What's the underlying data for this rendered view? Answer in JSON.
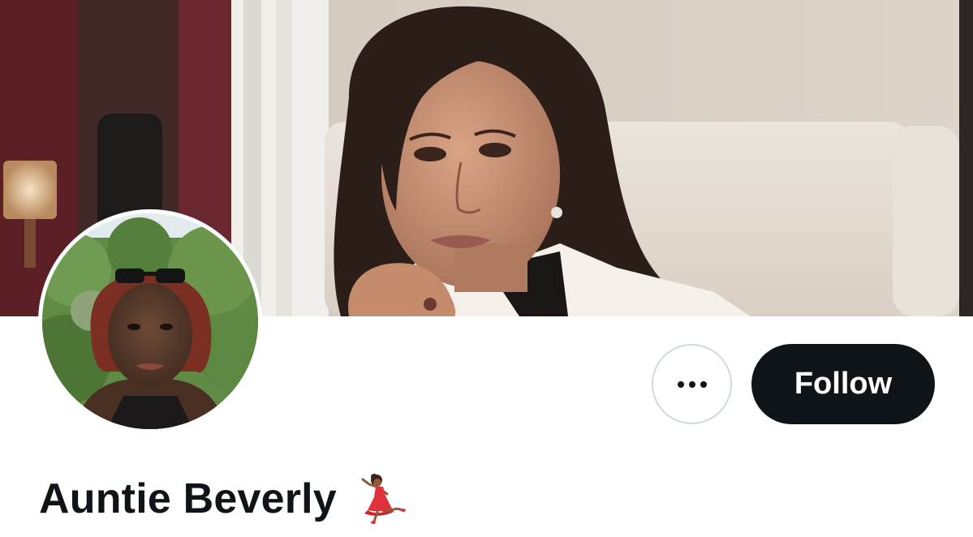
{
  "profile": {
    "display_name": "Auntie Beverly",
    "name_emoji": "dancer-emoji"
  },
  "actions": {
    "more_label": "More",
    "follow_label": "Follow"
  },
  "colors": {
    "primary_text": "#0f1419",
    "follow_button_bg": "#0f1419",
    "follow_button_text": "#ffffff",
    "more_button_border": "#cfd9de",
    "background": "#ffffff"
  }
}
